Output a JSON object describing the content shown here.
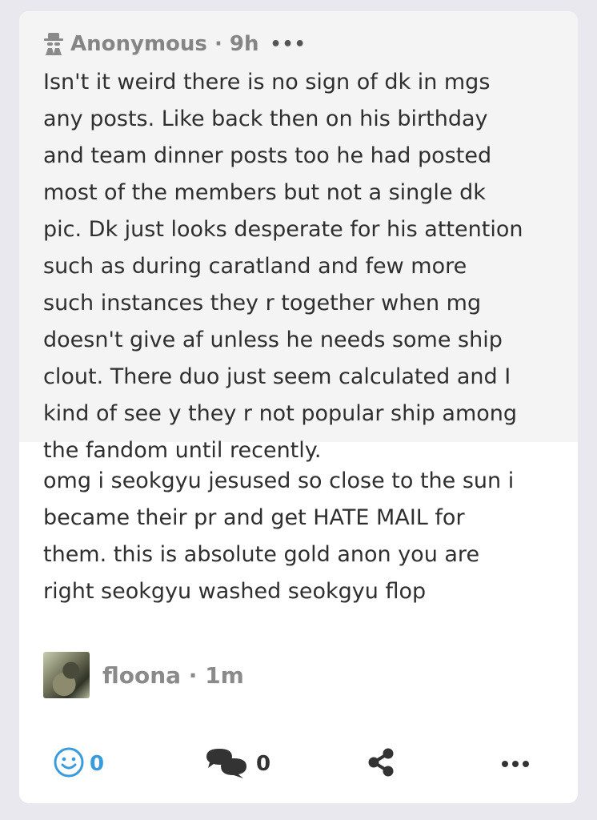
{
  "post": {
    "ask_author": "Anonymous",
    "ask_time": "9h",
    "ask_more": "•••",
    "ask_text": "Isn't it weird there is no sign of dk in mgs\nany posts. Like back then on his birthday\nand team dinner posts too he had posted\nmost of the members but not a single dk\npic. Dk just looks desperate for his attention\nsuch as during caratland and few more\nsuch instances they r together when mg\ndoesn't give af unless he needs some ship\nclout. There duo just seem calculated and I\nkind of see y they r not popular ship among\nthe fandom until recently.",
    "answer_text": "omg i seokgyu jesused so close to the sun i\nbecame their pr and get HATE MAIL for\nthem. this is absolute gold anon you are\nright seokgyu washed seokgyu flop",
    "answer_author": "floona",
    "answer_time": "1m"
  },
  "actions": {
    "smile_count": "0",
    "comment_count": "0",
    "more": "•••"
  },
  "icons": {
    "anon": "spy-icon",
    "smile": "smile-icon",
    "comment": "comment-icon",
    "share": "share-icon",
    "more": "more-icon"
  },
  "colors": {
    "accent": "#3a9bdc",
    "ask_bg": "#f4f4f4",
    "page_bg": "#e9e8ee"
  }
}
